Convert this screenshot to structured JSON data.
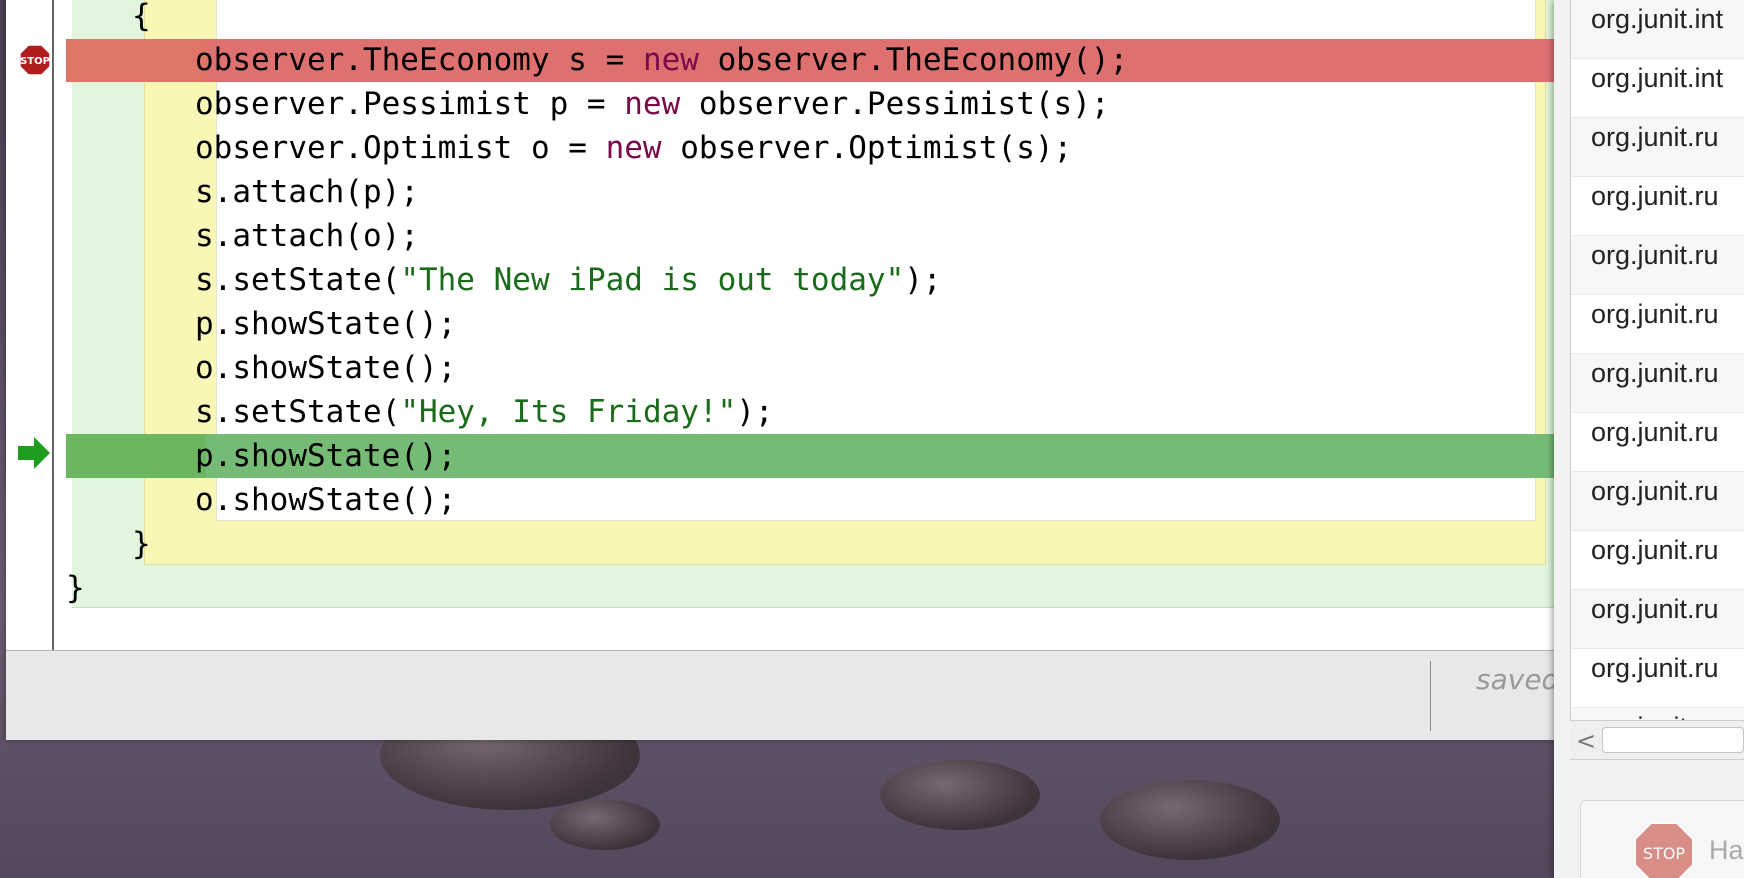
{
  "editor": {
    "lines": {
      "l1": {
        "text": "{"
      },
      "l2": {
        "a": "observer.TheEconomy s = ",
        "kw": "new",
        "b": " observer.TheEconomy();"
      },
      "l3": {
        "a": "observer.Pessimist p = ",
        "kw": "new",
        "b": " observer.Pessimist(s);"
      },
      "l4": {
        "a": "observer.Optimist o = ",
        "kw": "new",
        "b": " observer.Optimist(s);"
      },
      "l5": {
        "text": "s.attach(p);"
      },
      "l6": {
        "text": "s.attach(o);"
      },
      "l7": {
        "a": "s.setState(",
        "str": "\"The New iPad is out today\"",
        "b": ");"
      },
      "l8": {
        "text": "p.showState();"
      },
      "l9": {
        "text": "o.showState();"
      },
      "l10": {
        "a": "s.setState(",
        "str": "\"Hey, Its Friday!\"",
        "b": ");"
      },
      "l11": {
        "text": "p.showState();"
      },
      "l12": {
        "text": "o.showState();"
      },
      "l13": {
        "text": "}"
      },
      "l14": {
        "text": "}"
      }
    },
    "breakpoint_icon_label": "STOP",
    "status": {
      "saved": "saved"
    }
  },
  "side_panel": {
    "items": [
      "org.junit.int",
      "org.junit.int",
      "org.junit.ru",
      "org.junit.ru",
      "org.junit.ru",
      "org.junit.ru",
      "org.junit.ru",
      "org.junit.ru",
      "org.junit.ru",
      "org.junit.ru",
      "org.junit.ru",
      "org.junit.ru",
      "org.junit.ru"
    ],
    "scroll_left": "<",
    "halt_stop": "STOP",
    "halt_label": "Ha"
  },
  "colors": {
    "breakpoint_line": "#df7070",
    "execution_line": "#75bb75",
    "class_scope": "#e1f6dd",
    "method_scope": "#f8f7b5",
    "keyword": "#7b0a4a",
    "string": "#1a6b1a"
  }
}
